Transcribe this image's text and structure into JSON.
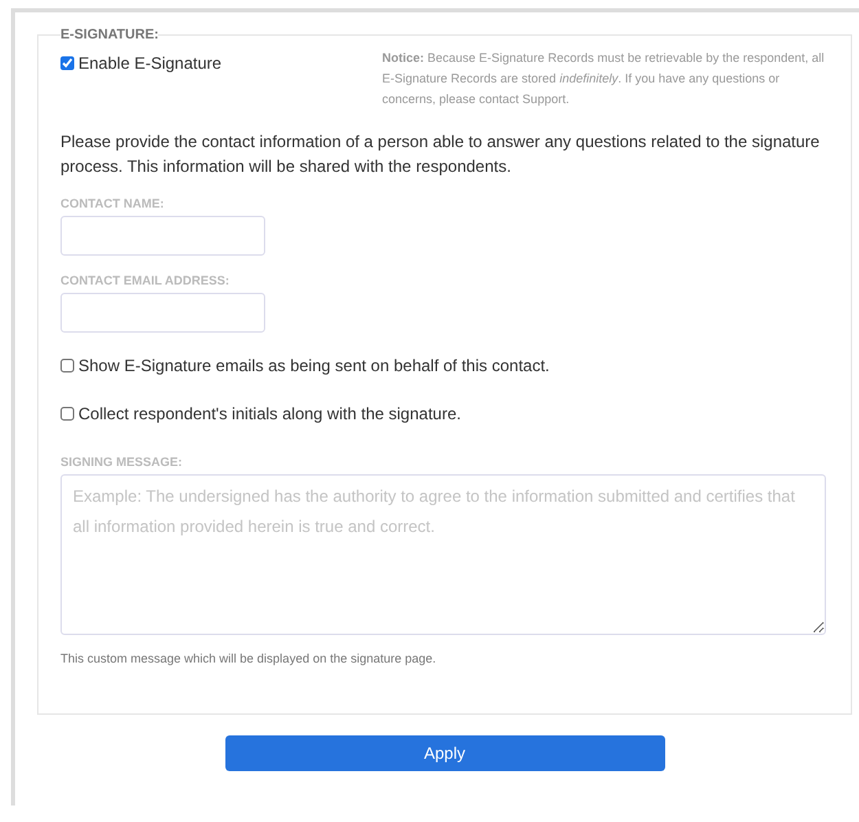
{
  "section": {
    "legend": "E-SIGNATURE:"
  },
  "enable": {
    "label": "Enable E-Signature",
    "checked": true
  },
  "notice": "**Notice:** Because E-Signature Records must be retrievable by the respondent, all E-Signature Records are stored *indefinitely*. If you have any questions or concerns, please contact Support.",
  "intro": "Please provide the contact information of a person able to answer any questions related to the signature process. This information will be shared with the respondents.",
  "fields": [
    {
      "label": "CONTACT NAME:"
    },
    {
      "label": "CONTACT EMAIL ADDRESS:"
    }
  ],
  "options": [
    {
      "label": "Show E-Signature emails as being sent on behalf of this contact.",
      "checked": false
    },
    {
      "label": "Collect respondent's initials along with the signature.",
      "checked": false
    }
  ],
  "message": {
    "label": "SIGNING MESSAGE:",
    "placeholder": "Example: The undersigned has the authority to agree to the information submitted and certifies that all information provided herein is true and correct.",
    "help": "This custom message which will be displayed on the signature page."
  },
  "button": "Apply"
}
